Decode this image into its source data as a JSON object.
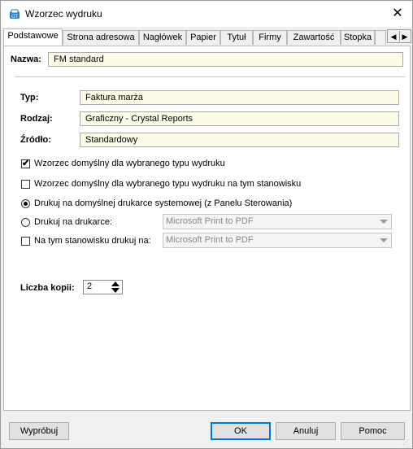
{
  "window": {
    "title": "Wzorzec wydruku",
    "close_glyph": "✕",
    "icon": "printer-template-icon"
  },
  "tabs": [
    {
      "label": "Podstawowe",
      "active": true
    },
    {
      "label": "Strona adresowa"
    },
    {
      "label": "Nagłówek"
    },
    {
      "label": "Papier"
    },
    {
      "label": "Tytuł"
    },
    {
      "label": "Firmy"
    },
    {
      "label": "Zawartość"
    },
    {
      "label": "Stopka"
    }
  ],
  "tab_scroll": {
    "left": "◀",
    "right": "▶"
  },
  "form": {
    "name_label": "Nazwa:",
    "name_value": "FM standard",
    "type_label": "Typ:",
    "type_value": "Faktura marża",
    "kind_label": "Rodzaj:",
    "kind_value": "Graficzny - Crystal Reports",
    "source_label": "Źródło:",
    "source_value": "Standardowy"
  },
  "options": {
    "default_type": {
      "label": "Wzorzec domyślny dla wybranego typu wydruku",
      "checked": true
    },
    "default_station": {
      "label": "Wzorzec domyślny dla wybranego typu wydruku na tym stanowisku",
      "checked": false
    },
    "print_default": {
      "label": "Drukuj na domyślnej drukarce systemowej (z Panelu Sterowania)",
      "selected": true
    },
    "print_on": {
      "label": "Drukuj na drukarce:",
      "selected": false,
      "value": "Microsoft Print to PDF"
    },
    "station_print": {
      "label": "Na tym stanowisku drukuj na:",
      "checked": false,
      "value": "Microsoft Print to PDF"
    },
    "check_glyph": "✔"
  },
  "copies": {
    "label": "Liczba kopii:",
    "value": "2"
  },
  "buttons": {
    "try": "Wypróbuj",
    "ok": "OK",
    "cancel": "Anuluj",
    "help": "Pomoc"
  },
  "colors": {
    "field_bg": "#fcfce8",
    "accent": "#0078d7",
    "disabled_text": "#8a8a8a"
  }
}
